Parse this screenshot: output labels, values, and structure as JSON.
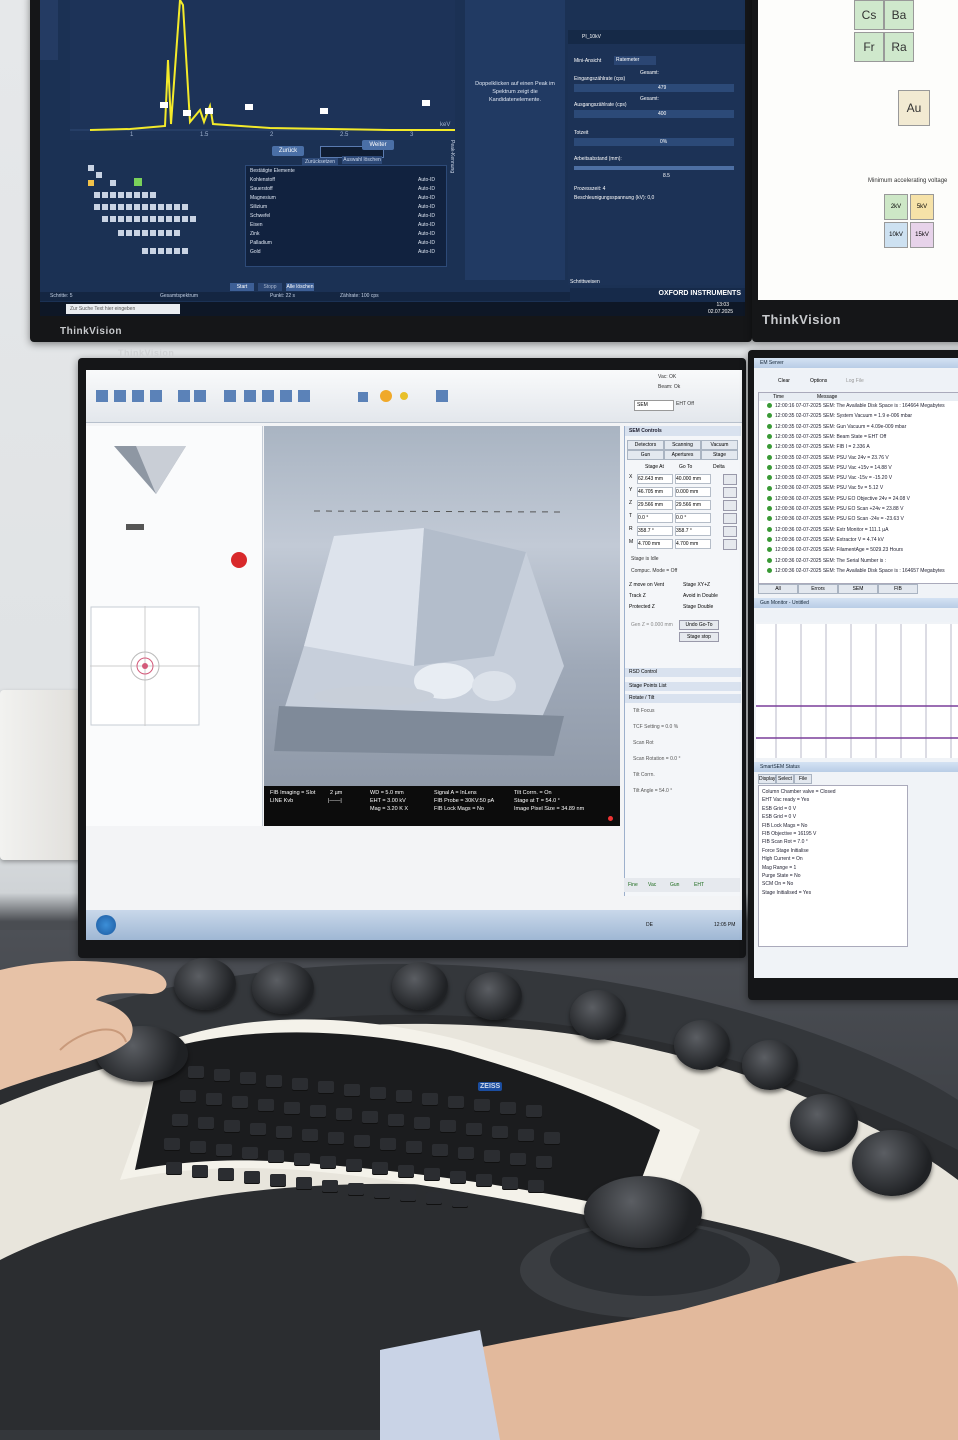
{
  "top_monitor": {
    "brand": "ThinkVision",
    "left_brand": "ThinkVision",
    "spectrum_axis_ticks": [
      "1",
      "1.5",
      "2",
      "2.5",
      "3",
      "3.5"
    ],
    "spectrum_unit": "keV",
    "buttons": {
      "left": "Zurück",
      "right": "Weiter",
      "sub1": "Zurücksetzen",
      "sub2": "Auswahl löschen"
    },
    "element_list_title": "Bestätigte Elemente",
    "elements": [
      "Kohlenstoff",
      "Sauerstoff",
      "Magnesium",
      "Silizium",
      "Schwefel",
      "Eisen",
      "Zink",
      "Palladium",
      "Gold"
    ],
    "element_tag": "Auto-ID",
    "peak_side_label": "Peak-Kennung",
    "hint_text": "Doppelklicken auf einen Peak im Spektrum zeigt die Kandidatenelemente.",
    "panel_header": "PI_10kV",
    "mini_view": "Mini-Ansicht",
    "ratemeter": "Ratemeter",
    "input_rate_label": "Eingangszählrate (cps)",
    "total_label": "Gesamt:",
    "input_rate_value": "479",
    "output_rate_label": "Ausgangszählrate (cps)",
    "output_rate_value": "400",
    "dead_time_label": "Totzeit",
    "dead_time_value": "0%",
    "work_distance_label": "Arbeitsabstand (mm):",
    "work_distance_value": "8.5",
    "process_time": "Prozesszeit: 4",
    "accel_voltage": "Beschleunigungsspannung (kV): 0,0",
    "step_label": "Schrittweisen",
    "vendor": "OXFORD INSTRUMENTS",
    "bottom_buttons": [
      "Start",
      "Stopp",
      "Alle löschen"
    ],
    "status_items": [
      "Schritte: 5",
      "Gesamtspektrum",
      "Punkt: 22 s",
      "Zählrate: 100 cps"
    ],
    "taskbar_search": "Zur Suche Text hier eingeben",
    "clock_time": "13:03",
    "clock_date": "02.07.2025",
    "periodic_cells": [
      "Cs",
      "Ba",
      "Fr",
      "Ra",
      "Au"
    ],
    "periodic_caption": "Minimum accelerating voltage",
    "voltage_cells": [
      "2kV",
      "5kV",
      "10kV",
      "15kV"
    ]
  },
  "sem_monitor": {
    "brand": "ThinkVision",
    "toolbar_right": {
      "vac": "Vac: OK",
      "beam": "Beam: Ok",
      "mode": "SEM",
      "eht": "EHT Off"
    },
    "image_info": {
      "col1": [
        "FIB Imaging = Slot",
        "LINE Kvb"
      ],
      "col2": [
        "2 µm",
        "|——|"
      ],
      "col3": [
        "WD = 5.0 mm",
        "EHT = 3.00 kV",
        "Mag = 3.20 K X"
      ],
      "col4": [
        "Signal A = InLens",
        "FIB Probe = 30KV:50 pA",
        "FIB Lock Mags = No"
      ],
      "col5": [
        "Tilt Corrn. = On",
        "Stage at T = 54.0 °",
        "Image Pixel Size = 34.89 nm"
      ]
    },
    "sem_controls_title": "SEM Controls",
    "tabs_row1": [
      "Detectors",
      "Scanning",
      "Vacuum"
    ],
    "tabs_row2": [
      "Gun",
      "Apertures",
      "Stage"
    ],
    "stage_header": [
      "Stage At",
      "Go To",
      "Delta"
    ],
    "stage_rows": [
      [
        "X",
        "62.643 mm",
        "40.000 mm"
      ],
      [
        "Y",
        "46.705 mm",
        "0.000 mm"
      ],
      [
        "Z",
        "29.566 mm",
        "29.566 mm"
      ],
      [
        "T",
        "0.0 °",
        "0.0 °"
      ],
      [
        "R",
        "358.7 °",
        "358.7 °"
      ],
      [
        "M",
        "4.700 mm",
        "4.700 mm"
      ]
    ],
    "stage_is_idle": "Stage is Idle",
    "compuc_label": "Compuc. Mode = Off",
    "checks": [
      "Z move on Vent",
      "Track Z",
      "Protected Z",
      "Stage XY+Z",
      "Avoid in Double",
      "Stage Double"
    ],
    "gen_z": "Gen Z = 0.000 mm",
    "btn_undo": "Undo Go-To",
    "btn_stop": "Stage stop",
    "rsd_control": "RSD Control",
    "stage_points": "Stage Points List",
    "rotate_tilt": "Rotate / Tilt",
    "tilt_items": [
      "Tilt Focus",
      "TCF Setting = 0.0 %",
      "Scan Rot",
      "Scan Rotation = 0.0 °",
      "Tilt Corrn.",
      "Tilt Angle = 54.0 °"
    ],
    "status_bar": [
      "Fine",
      "Vac",
      "Gun",
      "EHT"
    ],
    "clock": "12:05 PM",
    "lang": "DE"
  },
  "right_monitor": {
    "em_server_title": "EM Server",
    "em_toolbar": [
      "Clear",
      "Options",
      "Log File"
    ],
    "log_columns": [
      "Time",
      "Message"
    ],
    "log_rows": [
      [
        "12:00:16 07-07-2025",
        "SEM: The Available Disk Space is : 164664 Megabytes"
      ],
      [
        "12:00:35 02-07-2025",
        "SEM: System Vacuum = 1.9 e-006 mbar"
      ],
      [
        "12:00:35 02-07-2025",
        "SEM: Gun Vacuum = 4.09e-009 mbar"
      ],
      [
        "12:00:35 02-07-2025",
        "SEM: Beam State = EHT Off"
      ],
      [
        "12:00:35 02-07-2025",
        "SEM: FIB I = 2.336 A"
      ],
      [
        "12:00:35 02-07-2025",
        "SEM: PSU Vac 24v = 23.76 V"
      ],
      [
        "12:00:35 02-07-2025",
        "SEM: PSU Vac +15v = 14.88 V"
      ],
      [
        "12:00:35 02-07-2025",
        "SEM: PSU Vac -15v = -15.20 V"
      ],
      [
        "12:00:36 02-07-2025",
        "SEM: PSU Vac 5v = 5.12 V"
      ],
      [
        "12:00:36 02-07-2025",
        "SEM: PSU EO Objective 24v = 24.08 V"
      ],
      [
        "12:00:36 02-07-2025",
        "SEM: PSU EO Scan +24v = 23.88 V"
      ],
      [
        "12:00:36 02-07-2025",
        "SEM: PSU EO Scan -24v = -23.63 V"
      ],
      [
        "12:00:36 02-07-2025",
        "SEM: Extr Monitor = 111.1 µA"
      ],
      [
        "12:00:36 02-07-2025",
        "SEM: Extractor V = 4.74 kV"
      ],
      [
        "12:00:36 02-07-2025",
        "SEM: FilamentAge = 5029.23 Hours"
      ],
      [
        "12:00:36 02-07-2025",
        "SEM: The Serial Number is :"
      ],
      [
        "12:00:36 02-07-2025",
        "SEM: The Available Disk Space is : 164657 Megabytes"
      ]
    ],
    "em_tabs": [
      "All",
      "Errors",
      "SEM",
      "FIB"
    ],
    "gun_monitor_title": "Gun Monitor - Untitled",
    "smartsem_status_title": "SmartSEM Status",
    "status_tabs": [
      "Display",
      "Select",
      "File"
    ],
    "status_lines": [
      "Column Chamber valve = Closed",
      "EHT Vac ready = Yes",
      "ESB Grid = 0 V",
      "ESB Grid = 0 V",
      "FIB Lock Mags = No",
      "FIB Objective = 16195 V",
      "FIB Scan Rot = 7.0 °",
      "Force Stage Initialise",
      "High Current = On",
      "Mag Range = 1",
      "Purge State = No",
      "SCM On = No",
      "Stage Initialised = Yes"
    ]
  },
  "controller": {
    "brand_logo": "ZEISS"
  }
}
